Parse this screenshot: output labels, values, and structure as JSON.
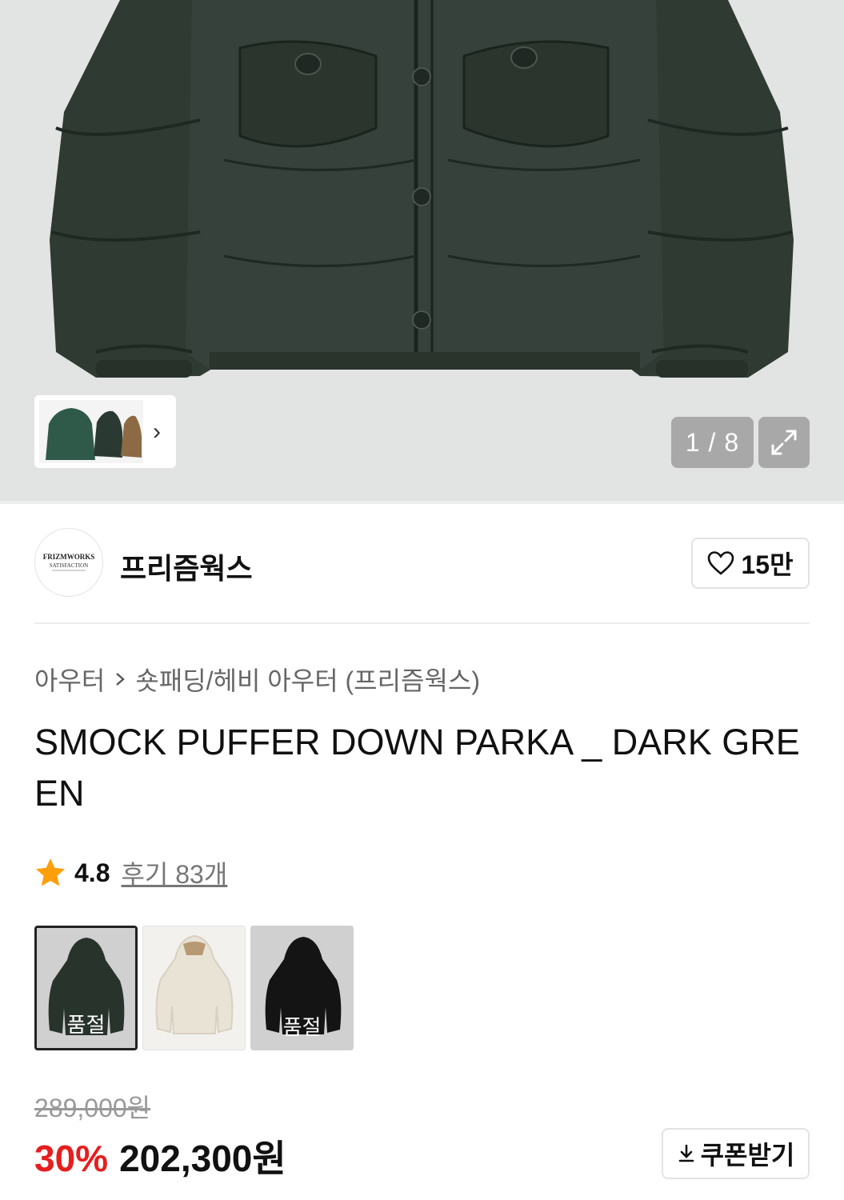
{
  "gallery": {
    "counter": "1 / 8",
    "thumb_arrow": "›"
  },
  "brand": {
    "name": "프리즘웍스",
    "logo_text": "FRIZMWORKS",
    "logo_subtext": "SATISFACTION",
    "likes": "15만"
  },
  "breadcrumb": {
    "category": "아우터",
    "subcategory": "숏패딩/헤비 아우터 (프리즘웍스)"
  },
  "product": {
    "title": "SMOCK PUFFER DOWN PARKA _ DARK GREEN"
  },
  "rating": {
    "score": "4.8",
    "reviews": "후기 83개"
  },
  "colors": [
    {
      "name": "dark-green",
      "status": "품절",
      "selected": true
    },
    {
      "name": "ivory",
      "status": "",
      "selected": false
    },
    {
      "name": "black",
      "status": "품절",
      "selected": false
    }
  ],
  "price": {
    "original": "289,000원",
    "discount": "30%",
    "sale": "202,300원"
  },
  "coupon": {
    "label": "쿠폰받기"
  },
  "theme": {
    "accent_red": "#e61e1e",
    "star": "#ff9f0a",
    "jacket_color": "#2f3a32"
  }
}
